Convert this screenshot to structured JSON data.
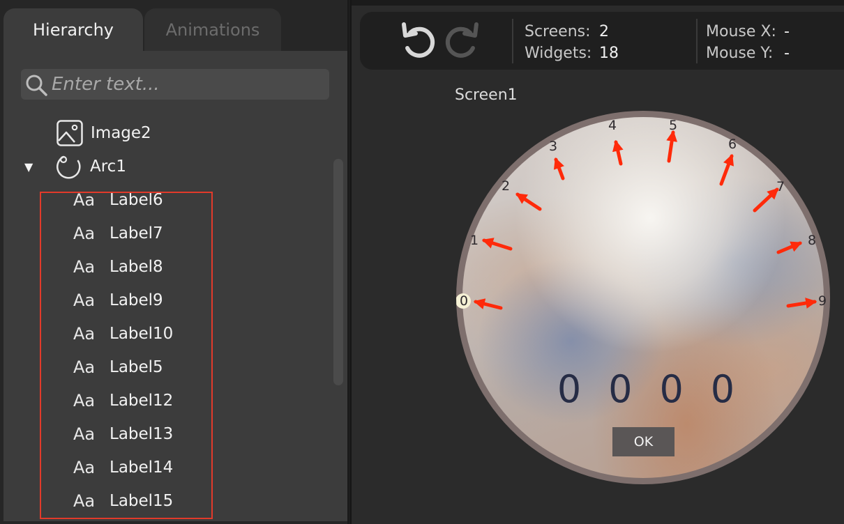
{
  "tabs": [
    {
      "label": "Hierarchy",
      "active": true
    },
    {
      "label": "Animations",
      "active": false
    }
  ],
  "search": {
    "placeholder": "Enter text..."
  },
  "tree": {
    "image_item": {
      "label": "Image2",
      "icon": "image-icon"
    },
    "arc_item": {
      "label": "Arc1",
      "icon": "arc-icon",
      "expanded": true
    },
    "label_items": [
      "Label6",
      "Label7",
      "Label8",
      "Label9",
      "Label10",
      "Label5",
      "Label12",
      "Label13",
      "Label14",
      "Label15"
    ],
    "label_icon_text": "Aa"
  },
  "toolbar": {
    "screens_label": "Screens:",
    "screens_value": "2",
    "widgets_label": "Widgets:",
    "widgets_value": "18",
    "mouse_x_label": "Mouse X:",
    "mouse_x_value": "-",
    "mouse_y_label": "Mouse Y:",
    "mouse_y_value": "-"
  },
  "canvas": {
    "screen_title": "Screen1",
    "dial_numbers": [
      "0",
      "1",
      "2",
      "3",
      "4",
      "5",
      "6",
      "7",
      "8",
      "9"
    ],
    "code_digits": [
      "0",
      "0",
      "0",
      "0"
    ],
    "ok_label": "OK"
  },
  "colors": {
    "selection_border": "#e23a2a",
    "arrow": "#ff2a0a",
    "digit_text": "#262c45"
  }
}
